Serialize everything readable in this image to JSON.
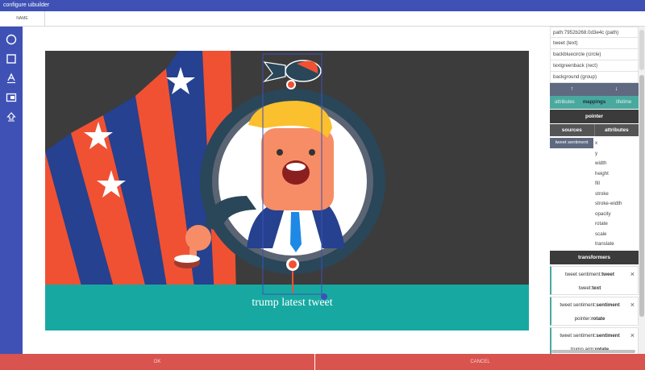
{
  "window": {
    "title": "configure uibuilder"
  },
  "name_tab": {
    "label": "NAME"
  },
  "toolbar": {
    "tools": [
      {
        "name": "circle-tool",
        "icon": "circle-icon"
      },
      {
        "name": "rect-tool",
        "icon": "square-icon"
      },
      {
        "name": "text-tool",
        "icon": "text-icon"
      },
      {
        "name": "image-tool",
        "icon": "image-icon"
      },
      {
        "name": "upload-tool",
        "icon": "upload-icon"
      }
    ]
  },
  "canvas": {
    "tweet_text": "trump latest tweet",
    "colors": {
      "background": "#3c3c3c",
      "teal": "#17a9a1",
      "stripe_red": "#f05133",
      "stripe_blue": "#25418f",
      "ring": "#2a4659",
      "skin": "#f68d66",
      "hair": "#fbc02d",
      "tie": "#1e88e5"
    }
  },
  "layers": [
    {
      "label": "path:7952b268.0d3e4c (path)"
    },
    {
      "label": "tweet (text)"
    },
    {
      "label": "backbluecircle (circle)"
    },
    {
      "label": "textgreenback (rect)"
    },
    {
      "label": "background (group)"
    }
  ],
  "move_bar": {
    "up": "↑",
    "down": "↓"
  },
  "mode_tabs": {
    "attributes": "attributes",
    "mappings": "mappings",
    "lifetime": "lifetime"
  },
  "pointer_header": "pointer",
  "split_header": {
    "sources": "sources",
    "attributes": "attributes"
  },
  "source_item": "tweet sentiment",
  "attr_items": [
    "x",
    "y",
    "width",
    "height",
    "fill",
    "stroke",
    "stroke-width",
    "opacity",
    "rotate",
    "scale",
    "translate"
  ],
  "transformers_header": "transformers",
  "transformers": [
    {
      "src": "tweet sentiment:",
      "src_bold": "tweet",
      "dst": "tweet:",
      "dst_bold": "text"
    },
    {
      "src": "tweet sentiment:",
      "src_bold": "sentiment",
      "dst": "pointer:",
      "dst_bold": "rotate"
    },
    {
      "src": "tweet sentiment:",
      "src_bold": "sentiment",
      "dst": "trump arm:",
      "dst_bold": "rotate"
    }
  ],
  "close_glyph": "×",
  "bottom": {
    "ok": "OK",
    "cancel": "CANCEL"
  }
}
